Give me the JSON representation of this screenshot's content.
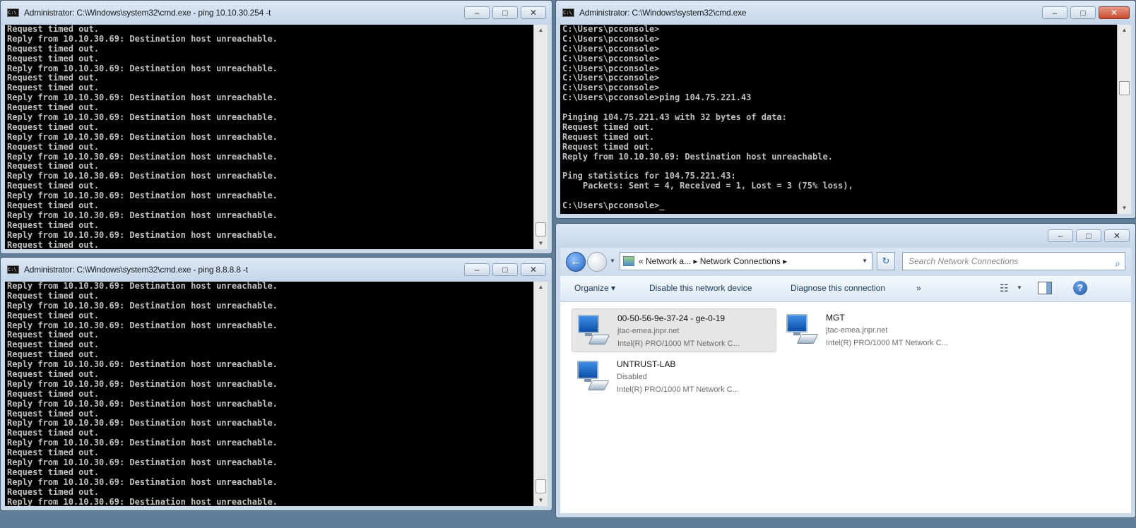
{
  "cmd_top_left": {
    "title": "Administrator: C:\\Windows\\system32\\cmd.exe - ping  10.10.30.254 -t",
    "lines": [
      "Request timed out.",
      "Reply from 10.10.30.69: Destination host unreachable.",
      "Request timed out.",
      "Request timed out.",
      "Reply from 10.10.30.69: Destination host unreachable.",
      "Request timed out.",
      "Request timed out.",
      "Reply from 10.10.30.69: Destination host unreachable.",
      "Request timed out.",
      "Reply from 10.10.30.69: Destination host unreachable.",
      "Request timed out.",
      "Reply from 10.10.30.69: Destination host unreachable.",
      "Request timed out.",
      "Reply from 10.10.30.69: Destination host unreachable.",
      "Request timed out.",
      "Reply from 10.10.30.69: Destination host unreachable.",
      "Request timed out.",
      "Reply from 10.10.30.69: Destination host unreachable.",
      "Request timed out.",
      "Reply from 10.10.30.69: Destination host unreachable.",
      "Request timed out.",
      "Reply from 10.10.30.69: Destination host unreachable.",
      "Request timed out.",
      "Reply from 10.10.30.69: Destination host unreachable."
    ]
  },
  "cmd_bottom_left": {
    "title": "Administrator: C:\\Windows\\system32\\cmd.exe - ping  8.8.8.8 -t",
    "lines": [
      "Reply from 10.10.30.69: Destination host unreachable.",
      "Request timed out.",
      "Reply from 10.10.30.69: Destination host unreachable.",
      "Request timed out.",
      "Reply from 10.10.30.69: Destination host unreachable.",
      "Request timed out.",
      "Request timed out.",
      "Request timed out.",
      "Reply from 10.10.30.69: Destination host unreachable.",
      "Request timed out.",
      "Reply from 10.10.30.69: Destination host unreachable.",
      "Request timed out.",
      "Reply from 10.10.30.69: Destination host unreachable.",
      "Request timed out.",
      "Reply from 10.10.30.69: Destination host unreachable.",
      "Request timed out.",
      "Reply from 10.10.30.69: Destination host unreachable.",
      "Request timed out.",
      "Reply from 10.10.30.69: Destination host unreachable.",
      "Request timed out.",
      "Reply from 10.10.30.69: Destination host unreachable.",
      "Request timed out.",
      "Reply from 10.10.30.69: Destination host unreachable."
    ]
  },
  "cmd_top_right": {
    "title": "Administrator: C:\\Windows\\system32\\cmd.exe",
    "lines": [
      "C:\\Users\\pcconsole>",
      "C:\\Users\\pcconsole>",
      "C:\\Users\\pcconsole>",
      "C:\\Users\\pcconsole>",
      "C:\\Users\\pcconsole>",
      "C:\\Users\\pcconsole>",
      "C:\\Users\\pcconsole>",
      "C:\\Users\\pcconsole>ping 104.75.221.43",
      "",
      "Pinging 104.75.221.43 with 32 bytes of data:",
      "Request timed out.",
      "Request timed out.",
      "Request timed out.",
      "Reply from 10.10.30.69: Destination host unreachable.",
      "",
      "Ping statistics for 104.75.221.43:",
      "    Packets: Sent = 4, Received = 1, Lost = 3 (75% loss),",
      "",
      "C:\\Users\\pcconsole>_"
    ]
  },
  "explorer": {
    "address": "«  Network a...  ▸  Network Connections  ▸",
    "search_placeholder": "Search Network Connections",
    "toolbar": {
      "organize": "Organize ▾",
      "disable": "Disable this network device",
      "diagnose": "Diagnose this connection",
      "more": "»"
    },
    "connections": [
      {
        "name": "00-50-56-9e-37-24 - ge-0-19",
        "status": "jtac-emea.jnpr.net",
        "device": "Intel(R) PRO/1000 MT Network C...",
        "selected": true
      },
      {
        "name": "MGT",
        "status": "jtac-emea.jnpr.net",
        "device": "Intel(R) PRO/1000 MT Network C...",
        "selected": false
      },
      {
        "name": "UNTRUST-LAB",
        "status": "Disabled",
        "device": "Intel(R) PRO/1000 MT Network C...",
        "selected": false
      }
    ]
  }
}
